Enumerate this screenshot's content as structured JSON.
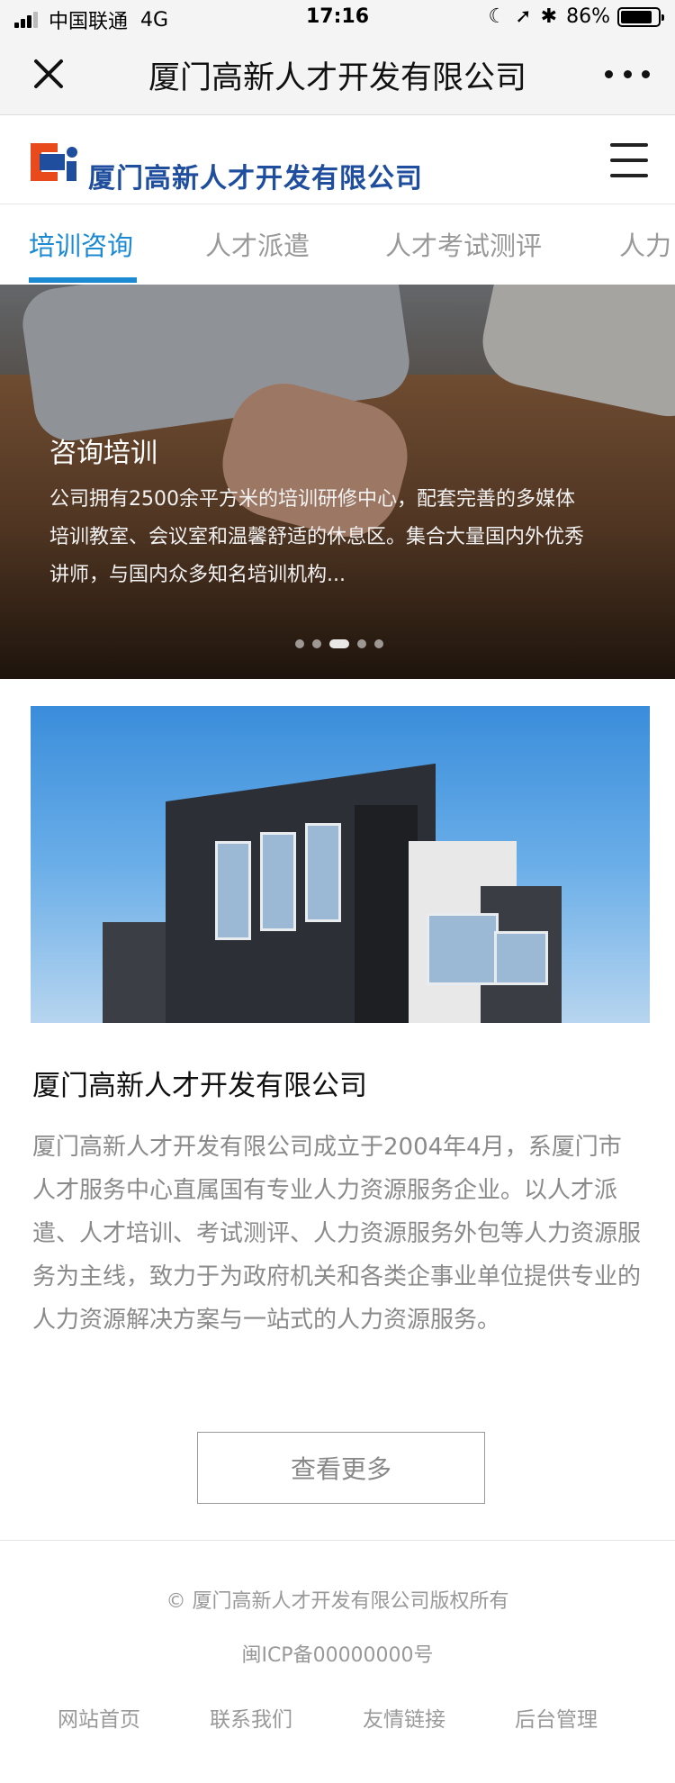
{
  "status_bar": {
    "carrier": "中国联通",
    "network": "4G",
    "time": "17:16",
    "battery": "86%",
    "battery_level": 0.86
  },
  "navbar": {
    "title": "厦门高新人才开发有限公司"
  },
  "header": {
    "logo_text": "厦门高新人才开发有限公司",
    "logo_colors": [
      "#e84a1c",
      "#1f4e9e"
    ]
  },
  "tabs": [
    {
      "label": "培训咨询",
      "active": true
    },
    {
      "label": "人才派遣",
      "active": false
    },
    {
      "label": "人才考试测评",
      "active": false
    },
    {
      "label": "人力",
      "active": false
    }
  ],
  "banner": {
    "title": "咨询培训",
    "description": "公司拥有2500余平方米的培训研修中心，配套完善的多媒体培训教室、会议室和温馨舒适的休息区。集合大量国内外优秀讲师，与国内众多知名培训机构...",
    "slide_count": 5,
    "active_slide": 3
  },
  "intro": {
    "title": "厦门高新人才开发有限公司",
    "body": "厦门高新人才开发有限公司成立于2004年4月，系厦门市人才服务中心直属国有专业人力资源服务企业。以人才派遣、人才培训、考试测评、人力资源服务外包等人力资源服务为主线，致力于为政府机关和各类企事业单位提供专业的人力资源解决方案与一站式的人力资源服务。",
    "more_label": "查看更多"
  },
  "footer": {
    "copyright": "© 厦门高新人才开发有限公司版权所有",
    "icp": "闽ICP备00000000号",
    "links": [
      "网站首页",
      "联系我们",
      "友情链接",
      "后台管理"
    ]
  },
  "colors": {
    "accent": "#1b8ad3",
    "text_muted": "#8a8a8a"
  }
}
